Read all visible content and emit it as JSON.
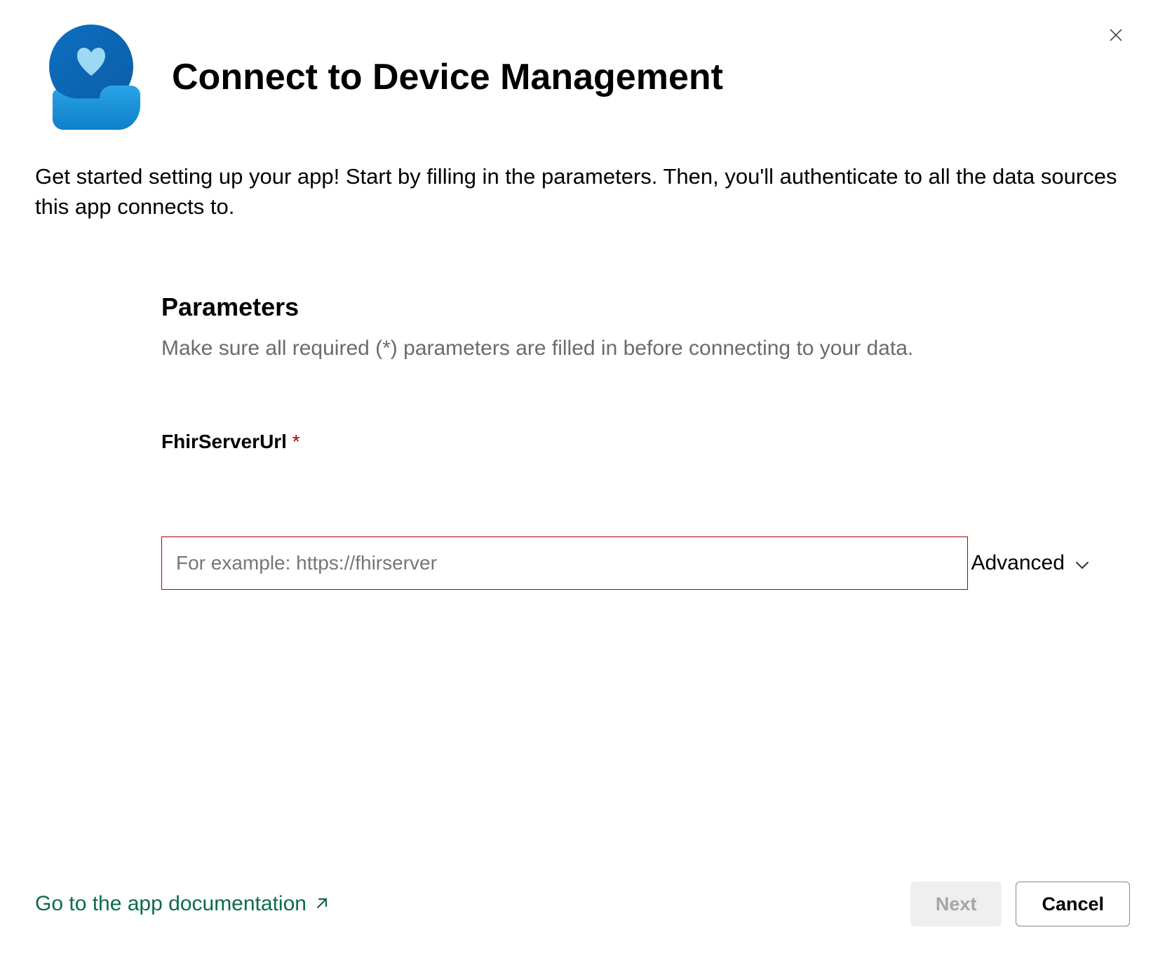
{
  "header": {
    "title": "Connect to Device Management"
  },
  "description": "Get started setting up your app! Start by filling in the parameters. Then, you'll authenticate to all the data sources this app connects to.",
  "parameters": {
    "title": "Parameters",
    "description": "Make sure all required (*) parameters are filled in before connecting to your data.",
    "fields": {
      "fhirServerUrl": {
        "label": "FhirServerUrl",
        "required": "*",
        "placeholder": "For example: https://fhirserver",
        "value": ""
      }
    },
    "advanced_label": "Advanced"
  },
  "footer": {
    "doc_link": "Go to the app documentation",
    "next_label": "Next",
    "cancel_label": "Cancel"
  }
}
